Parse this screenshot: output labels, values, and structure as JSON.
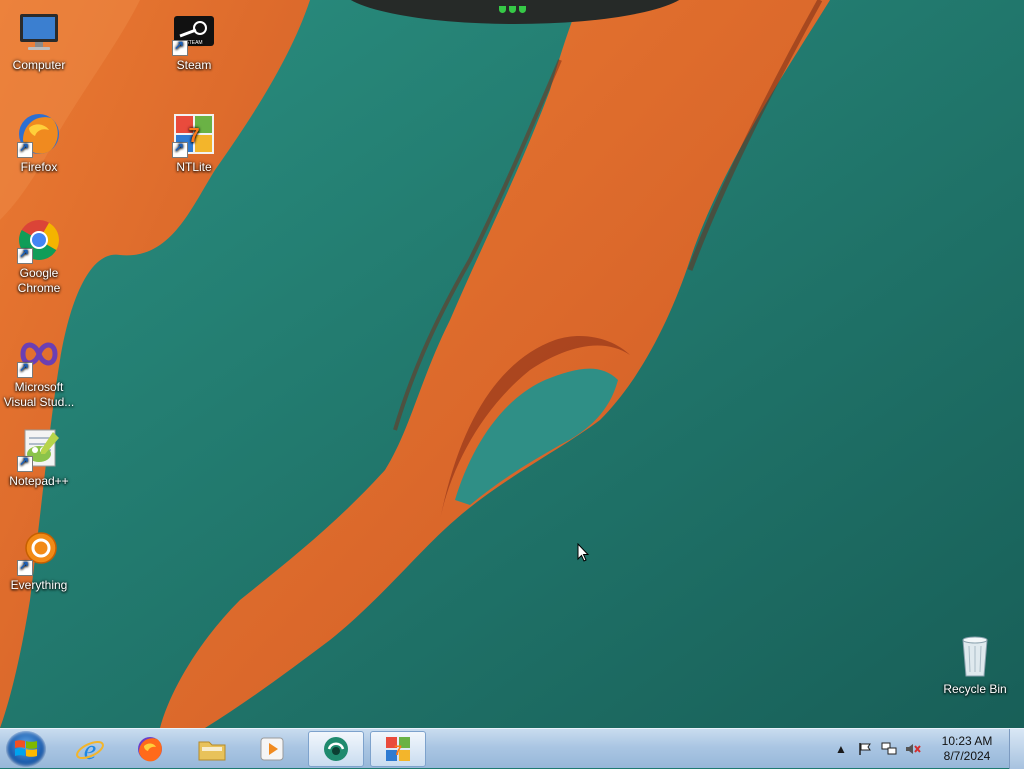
{
  "desktop": {
    "icons": [
      {
        "label": "Computer",
        "icon": "computer-icon",
        "shortcut": false
      },
      {
        "label": "Steam",
        "icon": "steam-icon",
        "shortcut": true
      },
      {
        "label": "Firefox",
        "icon": "firefox-icon",
        "shortcut": true
      },
      {
        "label": "NTLite",
        "icon": "ntlite-icon",
        "shortcut": true
      },
      {
        "label": "Google Chrome",
        "icon": "chrome-icon",
        "shortcut": true
      },
      {
        "label": "Microsoft Visual Stud...",
        "icon": "visual-studio-icon",
        "shortcut": true
      },
      {
        "label": "Notepad++",
        "icon": "notepadpp-icon",
        "shortcut": true
      },
      {
        "label": "Everything",
        "icon": "everything-icon",
        "shortcut": true
      },
      {
        "label": "Recycle Bin",
        "icon": "recycle-bin-icon",
        "shortcut": false
      }
    ]
  },
  "taskbar": {
    "start_icon": "windows-logo-icon",
    "pinned": [
      {
        "name": "internet-explorer",
        "icon": "internet-explorer-icon",
        "active": false
      },
      {
        "name": "firefox",
        "icon": "firefox-icon",
        "active": false
      },
      {
        "name": "file-explorer",
        "icon": "folder-icon",
        "active": false
      },
      {
        "name": "media-player",
        "icon": "media-player-icon",
        "active": false
      },
      {
        "name": "app-running",
        "icon": "green-circle-app-icon",
        "active": true
      },
      {
        "name": "ntlite",
        "icon": "ntlite-icon",
        "active": true
      }
    ],
    "tray": {
      "icons": [
        "show-hidden-icons-icon",
        "action-center-flag-icon",
        "network-icon",
        "volume-muted-icon"
      ],
      "time": "10:23 AM",
      "date": "8/7/2024"
    }
  },
  "colors": {
    "sea": "#1f7a70",
    "sand": "#e2702d",
    "taskbar": "#aac6e3"
  }
}
